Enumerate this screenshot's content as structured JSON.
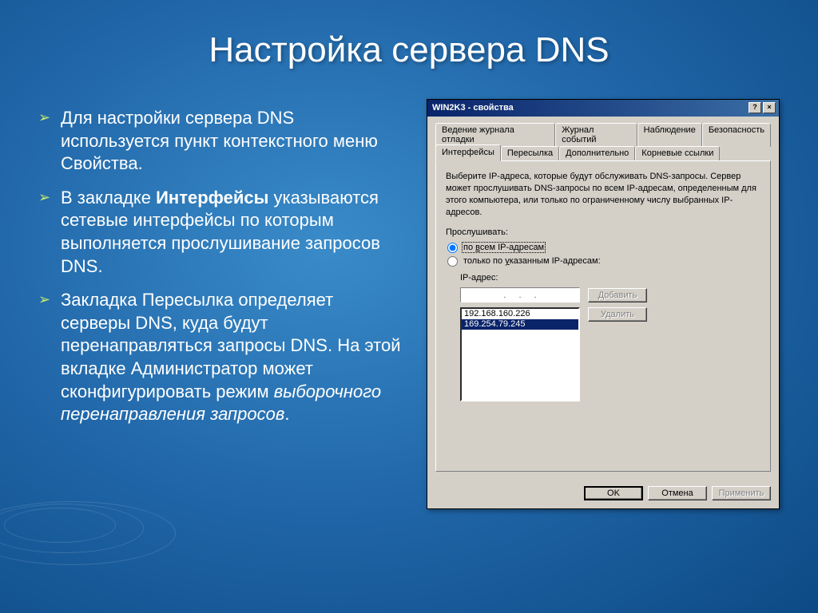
{
  "slide": {
    "title": "Настройка сервера DNS",
    "bullets": [
      {
        "pre": "Для настройки сервера DNS используется пункт контекстного меню Свойства."
      },
      {
        "pre": "В закладке ",
        "bold": "Интерфейсы",
        "post": " указываются сетевые интерфейсы по которым выполняется прослушивание запросов DNS."
      },
      {
        "pre": "Закладка Пересылка определяет серверы DNS, куда будут перенаправляться запросы DNS. На этой вкладке Администратор может сконфигурировать режим ",
        "italic": "выборочного перенаправления запросов",
        "post2": "."
      }
    ]
  },
  "dialog": {
    "title": "WIN2K3 - свойства",
    "help": "?",
    "close": "×",
    "tabs_back": [
      "Ведение журнала отладки",
      "Журнал событий",
      "Наблюдение",
      "Безопасность"
    ],
    "tabs_front": [
      "Интерфейсы",
      "Пересылка",
      "Дополнительно",
      "Корневые ссылки"
    ],
    "active_tab": "Интерфейсы",
    "description": "Выберите IP-адреса, которые будут обслуживать DNS-запросы. Сервер может прослушивать DNS-запросы по всем IP-адресам, определенным для этого компьютера, или только по ограниченному числу выбранных IP-адресов.",
    "listen_label": "Прослушивать:",
    "radio1": {
      "pre": "по ",
      "u": "в",
      "rest": "сем IP-адресам"
    },
    "radio2": {
      "pre": "только по ",
      "u": "у",
      "rest": "казанным IP-адресам:"
    },
    "ip_label": "IP-адрес:",
    "btn_add": "Добавить",
    "btn_del": "Удалить",
    "list": [
      "192.168.160.226",
      "169.254.79.245"
    ],
    "selected_index": 1,
    "ok": "OK",
    "cancel": "Отмена",
    "apply": "Применить"
  }
}
